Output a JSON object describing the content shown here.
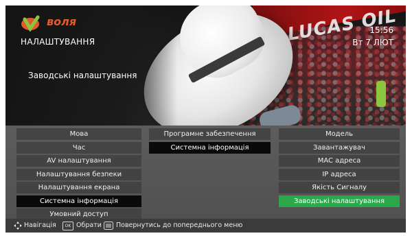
{
  "brand": {
    "name": "воля"
  },
  "header": {
    "section_title": "НАЛАШТУВАННЯ",
    "time": "15:56",
    "date": "Вт 7 ЛЮТ",
    "subtitle": "Заводські налаштування"
  },
  "background": {
    "banner_text": "LUCAS OIL"
  },
  "menu": {
    "column1": [
      {
        "label": "Мова",
        "state": "normal"
      },
      {
        "label": "Час",
        "state": "normal"
      },
      {
        "label": "AV налаштування",
        "state": "normal"
      },
      {
        "label": "Налаштування безпеки",
        "state": "normal"
      },
      {
        "label": "Налаштування екрана",
        "state": "normal"
      },
      {
        "label": "Системна інформація",
        "state": "selected"
      },
      {
        "label": "Умовний доступ",
        "state": "normal"
      }
    ],
    "column2": [
      {
        "label": "Програмне забезпечення",
        "state": "normal"
      },
      {
        "label": "Системна інформація",
        "state": "selected"
      }
    ],
    "column3": [
      {
        "label": "Модель",
        "state": "normal"
      },
      {
        "label": "Завантажувач",
        "state": "normal"
      },
      {
        "label": "MAC адреса",
        "state": "normal"
      },
      {
        "label": "IP адреса",
        "state": "normal"
      },
      {
        "label": "Якість Сигналу",
        "state": "normal"
      },
      {
        "label": "Заводські налаштування",
        "state": "focused"
      }
    ]
  },
  "footer": {
    "navigate_label": "Навігація",
    "ok_key": "OK",
    "select_label": "Обрати",
    "back_label": "Повернутись до попереднього меню"
  },
  "colors": {
    "focus": "#2aa84a",
    "brand_orange": "#e35a2b",
    "brand_green": "#8cc63f"
  }
}
